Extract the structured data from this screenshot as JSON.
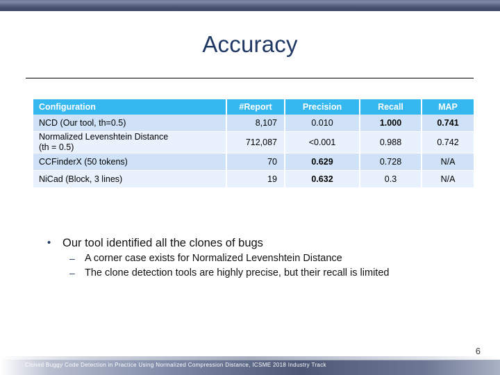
{
  "slide": {
    "title": "Accuracy",
    "page_number": "6",
    "footer": "Cloned Buggy Code Detection in Practice Using Normalized Compression Distance, ICSME 2018 Industry Track"
  },
  "colors": {
    "title": "#1f3864",
    "table_header_bg": "#35b7ef",
    "row_odd_bg": "#cfe2f7",
    "row_even_bg": "#e9f1fc",
    "top_bar": "#4b5573"
  },
  "table": {
    "headers": {
      "configuration": "Configuration",
      "report": "#Report",
      "precision": "Precision",
      "recall": "Recall",
      "map": "MAP"
    },
    "rows": [
      {
        "configuration": "NCD (Our tool, th=0.5)",
        "configuration_line2": "",
        "report": "8,107",
        "precision": "0.010",
        "recall": "1.000",
        "map": "0.741",
        "bold": {
          "report": false,
          "precision": false,
          "recall": true,
          "map": true
        }
      },
      {
        "configuration": "Normalized Levenshtein Distance",
        "configuration_line2": "(th = 0.5)",
        "report": "712,087",
        "precision": "<0.001",
        "recall": "0.988",
        "map": "0.742",
        "bold": {
          "report": false,
          "precision": false,
          "recall": false,
          "map": false
        }
      },
      {
        "configuration": "CCFinderX (50 tokens)",
        "configuration_line2": "",
        "report": "70",
        "precision": "0.629",
        "recall": "0.728",
        "map": "N/A",
        "bold": {
          "report": false,
          "precision": true,
          "recall": false,
          "map": false
        }
      },
      {
        "configuration": "NiCad (Block, 3 lines)",
        "configuration_line2": "",
        "report": "19",
        "precision": "0.632",
        "recall": "0.3",
        "map": "N/A",
        "bold": {
          "report": false,
          "precision": true,
          "recall": false,
          "map": false
        }
      }
    ]
  },
  "bullets": {
    "level1_marker": "•",
    "level2_marker": "–",
    "main": "Our tool identified all the clones of bugs",
    "sub": [
      "A corner case exists for Normalized Levenshtein Distance",
      "The clone detection tools are highly precise, but their recall is limited"
    ]
  }
}
